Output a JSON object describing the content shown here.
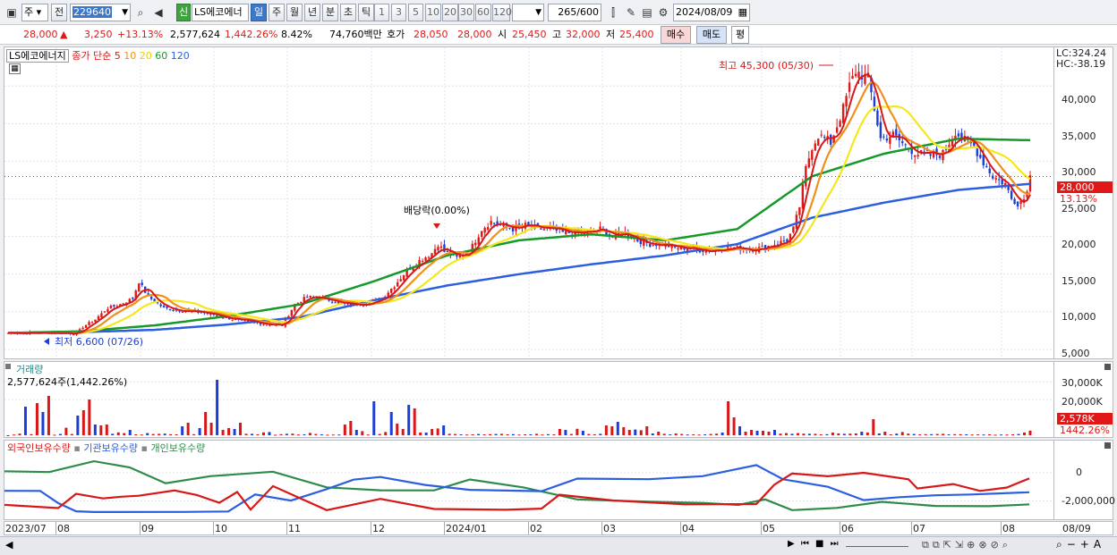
{
  "toolbar": {
    "market": "주",
    "prev": "전",
    "code": "229640",
    "sin": "신",
    "name": "LS에코에너",
    "periods": [
      "일",
      "주",
      "월",
      "년",
      "분",
      "초",
      "틱"
    ],
    "selected_period": "일",
    "nums": [
      "1",
      "3",
      "5",
      "10",
      "20",
      "30",
      "60",
      "120"
    ],
    "count": "265",
    "count_total": "/600",
    "date": "2024/08/09"
  },
  "quote": {
    "price": "28,000",
    "change_arrow": "▲",
    "change": "3,250",
    "change_pct": "+13.13%",
    "volume": "2,577,624",
    "volume_pct": "1,442.26%",
    "turnover_pct": "8.42%",
    "amount": "74,760백만",
    "hoga_label": "호가",
    "hoga1": "28,050",
    "hoga2": "28,000",
    "open_label": "시",
    "open": "25,450",
    "high_label": "고",
    "high": "32,000",
    "low_label": "저",
    "low": "25,400",
    "buy": "매수",
    "sell": "매도",
    "eval": "평"
  },
  "price_panel": {
    "stock": "LS에코에너지",
    "ma_label": "종가 단순 5",
    "ma_periods": [
      "10",
      "20",
      "60",
      "120"
    ],
    "ma_colors": {
      "5": "#d81818",
      "10": "#f0901c",
      "20": "#f4e81c",
      "60": "#159a2a",
      "120": "#2c5ee0"
    },
    "lc": "LC:324.24",
    "hc": "HC:-38.19",
    "y_ticks": [
      "40,000",
      "35,000",
      "30,000",
      "25,000",
      "20,000",
      "15,000",
      "10,000",
      "5,000"
    ],
    "current_tag": "28,000",
    "current_pct": "13.13%",
    "high_note": "최고 45,300 (05/30)",
    "low_note": "최저 6,600 (07/26)",
    "div_note": "배당락(0.00%)"
  },
  "volume_panel": {
    "title": "거래량",
    "info": "2,577,624주(1,442.26%)",
    "y_ticks": [
      "30,000K",
      "20,000K"
    ],
    "current_tag": "2,578K",
    "current_pct": "1442.26%"
  },
  "holding_panel": {
    "series": [
      "외국인보유수량",
      "기관보유수량",
      "개인보유수량"
    ],
    "series_colors": [
      "#d81818",
      "#2c5ee0",
      "#2e8b4a"
    ],
    "y_ticks": [
      "0",
      "-2,000,000"
    ]
  },
  "x_axis": {
    "labels": [
      "2023/07",
      "08",
      "09",
      "10",
      "11",
      "12",
      "2024/01",
      "02",
      "03",
      "04",
      "05",
      "06",
      "07",
      "08"
    ],
    "right_label": "08/09"
  },
  "chart_data": {
    "type": "line",
    "title": "LS에코에너지",
    "x_range": [
      "2023/07",
      "2024/08/09"
    ],
    "price_ylim": [
      5000,
      43000
    ],
    "price_path": [
      [
        0,
        7200
      ],
      [
        18,
        7200
      ],
      [
        22,
        7100
      ],
      [
        24,
        8000
      ],
      [
        28,
        9000
      ],
      [
        32,
        10500
      ],
      [
        36,
        11000
      ],
      [
        40,
        11800
      ],
      [
        42,
        14000
      ],
      [
        45,
        12000
      ],
      [
        50,
        10500
      ],
      [
        55,
        10200
      ],
      [
        60,
        10000
      ],
      [
        65,
        9700
      ],
      [
        70,
        9200
      ],
      [
        75,
        8800
      ],
      [
        80,
        8500
      ],
      [
        85,
        8300
      ],
      [
        88,
        8200
      ],
      [
        92,
        11000
      ],
      [
        96,
        12000
      ],
      [
        100,
        11800
      ],
      [
        104,
        11500
      ],
      [
        108,
        11000
      ],
      [
        112,
        11000
      ],
      [
        116,
        11200
      ],
      [
        120,
        11800
      ],
      [
        124,
        13500
      ],
      [
        128,
        15500
      ],
      [
        132,
        16800
      ],
      [
        136,
        17800
      ],
      [
        138,
        19000
      ],
      [
        140,
        18000
      ],
      [
        144,
        17200
      ],
      [
        148,
        18000
      ],
      [
        152,
        21000
      ],
      [
        155,
        22000
      ],
      [
        158,
        21500
      ],
      [
        162,
        21000
      ],
      [
        166,
        21500
      ],
      [
        170,
        21000
      ],
      [
        174,
        21000
      ],
      [
        178,
        20500
      ],
      [
        182,
        20500
      ],
      [
        186,
        20500
      ],
      [
        190,
        21000
      ],
      [
        194,
        20000
      ],
      [
        198,
        20500
      ],
      [
        202,
        19500
      ],
      [
        206,
        19000
      ],
      [
        210,
        19000
      ],
      [
        214,
        18500
      ],
      [
        218,
        18500
      ],
      [
        222,
        18200
      ],
      [
        226,
        18200
      ],
      [
        230,
        18500
      ],
      [
        234,
        18500
      ],
      [
        238,
        18300
      ],
      [
        242,
        18500
      ],
      [
        246,
        19000
      ],
      [
        250,
        19500
      ],
      [
        252,
        21000
      ],
      [
        254,
        24000
      ],
      [
        256,
        29000
      ],
      [
        258,
        32000
      ],
      [
        260,
        33500
      ],
      [
        264,
        32500
      ],
      [
        268,
        37000
      ],
      [
        270,
        40000
      ],
      [
        272,
        42000
      ],
      [
        276,
        41000
      ],
      [
        278,
        37000
      ],
      [
        280,
        33000
      ],
      [
        284,
        33500
      ],
      [
        288,
        32000
      ],
      [
        292,
        31000
      ],
      [
        296,
        30800
      ],
      [
        300,
        31000
      ],
      [
        304,
        34000
      ],
      [
        306,
        33000
      ],
      [
        308,
        32500
      ],
      [
        310,
        32000
      ],
      [
        312,
        30500
      ],
      [
        316,
        28000
      ],
      [
        320,
        27000
      ],
      [
        322,
        25000
      ],
      [
        324,
        24500
      ],
      [
        326,
        25000
      ],
      [
        328,
        28000
      ]
    ],
    "ma60": [
      7200,
      7400,
      8200,
      9400,
      11000,
      14000,
      17500,
      19500,
      20300,
      19500,
      21000,
      28000,
      31000,
      33000,
      32800
    ],
    "ma120": [
      7200,
      7300,
      7600,
      8300,
      9300,
      11500,
      13500,
      15000,
      16300,
      17500,
      19000,
      22500,
      24500,
      26200,
      27000
    ],
    "volume_k": [
      0,
      400,
      900,
      16000,
      600,
      18000,
      13000,
      22000,
      300,
      700,
      4200,
      700,
      11000,
      14000,
      20000,
      6000,
      5500,
      6000,
      800,
      1600,
      1200,
      3000,
      500,
      400,
      1200,
      700,
      800,
      900,
      600,
      500,
      5000,
      7000,
      600,
      4000,
      13000,
      7000,
      31000,
      3000,
      4000,
      3500,
      7000,
      800,
      800,
      500,
      1600,
      1800,
      300,
      600,
      800,
      900,
      400,
      500,
      1300,
      700,
      500,
      300,
      400,
      400,
      6000,
      8000,
      3000,
      2300,
      400,
      19000,
      700,
      1800,
      13000,
      6500,
      3500,
      17000,
      15000,
      1500,
      1500,
      3500,
      3800,
      5500,
      800,
      700,
      500,
      400,
      500,
      700,
      500,
      600,
      700,
      800,
      500,
      600,
      400,
      500,
      500,
      800,
      400,
      600,
      500,
      3500,
      3000,
      700,
      3600,
      2500,
      700,
      500,
      800,
      5500,
      5000,
      7500,
      4500,
      3000,
      3200,
      2800,
      5000,
      1000,
      2000,
      800,
      500,
      1000,
      700,
      400,
      500,
      400,
      500,
      700,
      900,
      1500,
      19000,
      10000,
      5000,
      2000,
      3000,
      2500,
      2500,
      2000,
      3000,
      900,
      1200,
      800,
      1200,
      900,
      800,
      800,
      500,
      600,
      1500,
      1000,
      800,
      900,
      1000,
      2000,
      1500,
      9000,
      1000,
      2000,
      500,
      900,
      1800,
      900,
      700,
      500,
      600,
      600,
      700,
      800,
      500,
      600,
      600,
      500,
      400,
      500,
      400,
      500,
      300,
      400,
      400,
      500,
      700,
      1500,
      2578
    ],
    "foreign": [
      [
        0,
        -2250000
      ],
      [
        60,
        -2500000
      ],
      [
        80,
        -1500000
      ],
      [
        110,
        -1800000
      ],
      [
        130,
        -1700000
      ],
      [
        150,
        -1600000
      ],
      [
        190,
        -1200000
      ],
      [
        215,
        -1600000
      ],
      [
        240,
        -2100000
      ],
      [
        260,
        -1400000
      ],
      [
        275,
        -2600000
      ],
      [
        300,
        -1000000
      ],
      [
        360,
        -2600000
      ],
      [
        420,
        -1800000
      ],
      [
        480,
        -2600000
      ],
      [
        560,
        -2600000
      ],
      [
        600,
        -2500000
      ],
      [
        620,
        -1500000
      ],
      [
        680,
        -2000000
      ],
      [
        760,
        -2300000
      ],
      [
        840,
        -2200000
      ],
      [
        860,
        -800000
      ],
      [
        880,
        0
      ],
      [
        920,
        -300000
      ],
      [
        960,
        0
      ],
      [
        1010,
        -500000
      ],
      [
        1020,
        -1100000
      ],
      [
        1060,
        -800000
      ],
      [
        1090,
        -1300000
      ],
      [
        1120,
        -1100000
      ],
      [
        1145,
        -400000
      ]
    ],
    "institution": [
      [
        0,
        -1300000
      ],
      [
        40,
        -1300000
      ],
      [
        60,
        -2200000
      ],
      [
        80,
        -2700000
      ],
      [
        100,
        -2800000
      ],
      [
        200,
        -2800000
      ],
      [
        250,
        -2700000
      ],
      [
        280,
        -1500000
      ],
      [
        320,
        -2000000
      ],
      [
        360,
        -1200000
      ],
      [
        390,
        -500000
      ],
      [
        420,
        -300000
      ],
      [
        470,
        -900000
      ],
      [
        520,
        -1200000
      ],
      [
        600,
        -1300000
      ],
      [
        640,
        -400000
      ],
      [
        720,
        -400000
      ],
      [
        780,
        -300000
      ],
      [
        840,
        600000
      ],
      [
        870,
        -500000
      ],
      [
        920,
        -1000000
      ],
      [
        960,
        -1900000
      ],
      [
        1000,
        -1700000
      ],
      [
        1040,
        -1600000
      ],
      [
        1080,
        -1500000
      ],
      [
        1145,
        -1400000
      ]
    ],
    "individual": [
      [
        0,
        100000
      ],
      [
        50,
        100000
      ],
      [
        100,
        800000
      ],
      [
        140,
        400000
      ],
      [
        180,
        -700000
      ],
      [
        230,
        -200000
      ],
      [
        300,
        100000
      ],
      [
        360,
        -1000000
      ],
      [
        420,
        -1200000
      ],
      [
        480,
        -1300000
      ],
      [
        520,
        -500000
      ],
      [
        580,
        -1100000
      ],
      [
        640,
        -1900000
      ],
      [
        720,
        -2000000
      ],
      [
        780,
        -2100000
      ],
      [
        820,
        -2300000
      ],
      [
        850,
        -1900000
      ],
      [
        880,
        -2600000
      ],
      [
        930,
        -2500000
      ],
      [
        980,
        -2100000
      ],
      [
        1040,
        -2300000
      ],
      [
        1100,
        -2400000
      ],
      [
        1145,
        -2200000
      ]
    ]
  }
}
